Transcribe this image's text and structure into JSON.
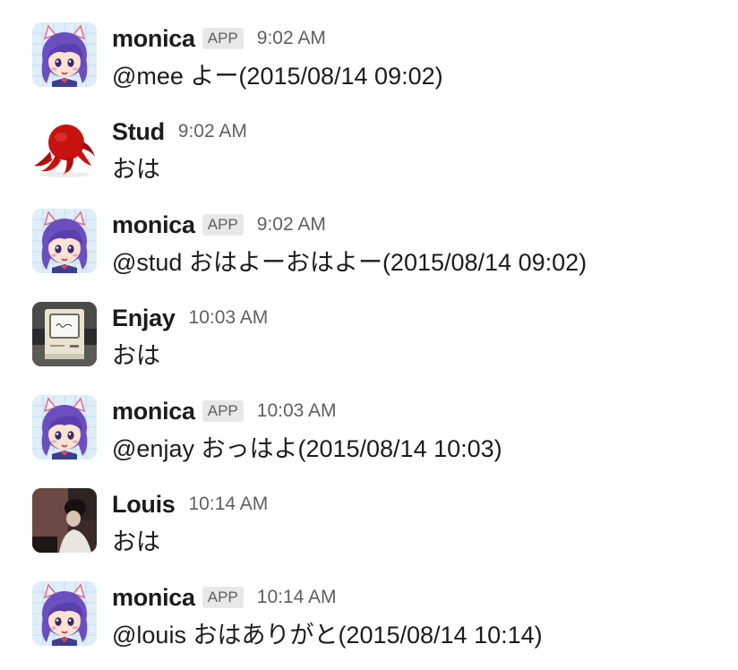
{
  "messages": [
    {
      "sender": "monica",
      "badge": "APP",
      "time": "9:02 AM",
      "text": "@mee よー(2015/08/14 09:02)",
      "avatar": "monica-avatar"
    },
    {
      "sender": "Stud",
      "badge": "",
      "time": "9:02 AM",
      "text": "おは",
      "avatar": "red-octopus-avatar"
    },
    {
      "sender": "monica",
      "badge": "APP",
      "time": "9:02 AM",
      "text": "@stud おはよーおはよー(2015/08/14 09:02)",
      "avatar": "monica-avatar"
    },
    {
      "sender": "Enjay",
      "badge": "",
      "time": "10:03 AM",
      "text": "おは",
      "avatar": "macintosh-avatar"
    },
    {
      "sender": "monica",
      "badge": "APP",
      "time": "10:03 AM",
      "text": "@enjay おっはよ(2015/08/14 10:03)",
      "avatar": "monica-avatar"
    },
    {
      "sender": "Louis",
      "badge": "",
      "time": "10:14 AM",
      "text": "おは",
      "avatar": "louis-photo-avatar"
    },
    {
      "sender": "monica",
      "badge": "APP",
      "time": "10:14 AM",
      "text": "@louis おはありがと(2015/08/14 10:14)",
      "avatar": "monica-avatar"
    }
  ]
}
